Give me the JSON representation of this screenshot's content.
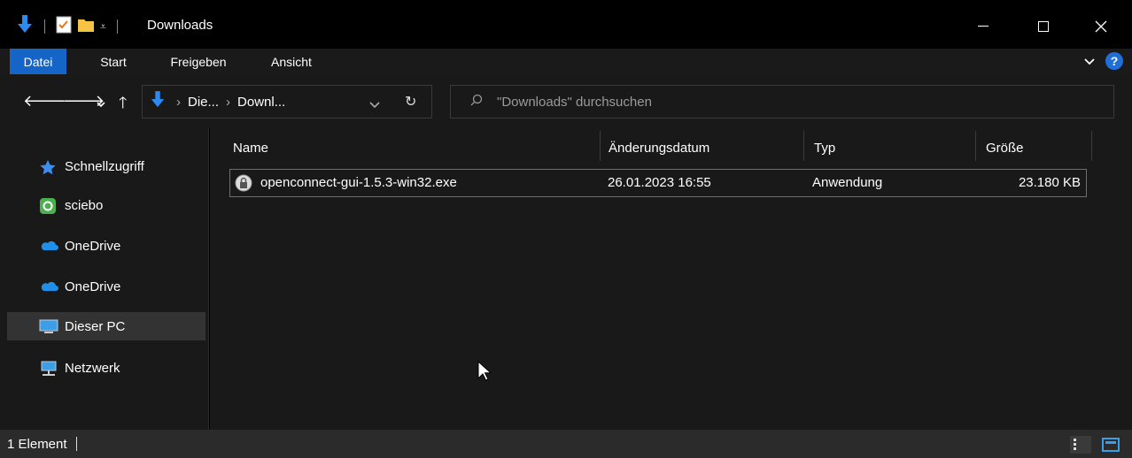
{
  "window": {
    "title": "Downloads"
  },
  "ribbon": {
    "tabs": [
      "Datei",
      "Start",
      "Freigeben",
      "Ansicht"
    ]
  },
  "address": {
    "crumbs": [
      "Die...",
      "Downl..."
    ],
    "search_placeholder": "\"Downloads\" durchsuchen"
  },
  "nav": {
    "items": [
      {
        "label": "Schnellzugriff",
        "icon": "star-icon"
      },
      {
        "label": "sciebo",
        "icon": "sciebo-icon"
      },
      {
        "label": "OneDrive",
        "icon": "cloud-icon"
      },
      {
        "label": "OneDrive",
        "icon": "cloud-icon"
      },
      {
        "label": "Dieser PC",
        "icon": "monitor-icon"
      },
      {
        "label": "Netzwerk",
        "icon": "network-icon"
      }
    ],
    "selected": "Dieser PC"
  },
  "files": {
    "columns": [
      "Name",
      "Änderungsdatum",
      "Typ",
      "Größe"
    ],
    "rows": [
      {
        "name": "openconnect-gui-1.5.3-win32.exe",
        "date": "26.01.2023 16:55",
        "type": "Anwendung",
        "size": "23.180 KB"
      }
    ]
  },
  "status": {
    "count": "1 Element"
  },
  "colors": {
    "accent": "#1565c8",
    "background": "#191919",
    "titlebar": "#000000"
  }
}
